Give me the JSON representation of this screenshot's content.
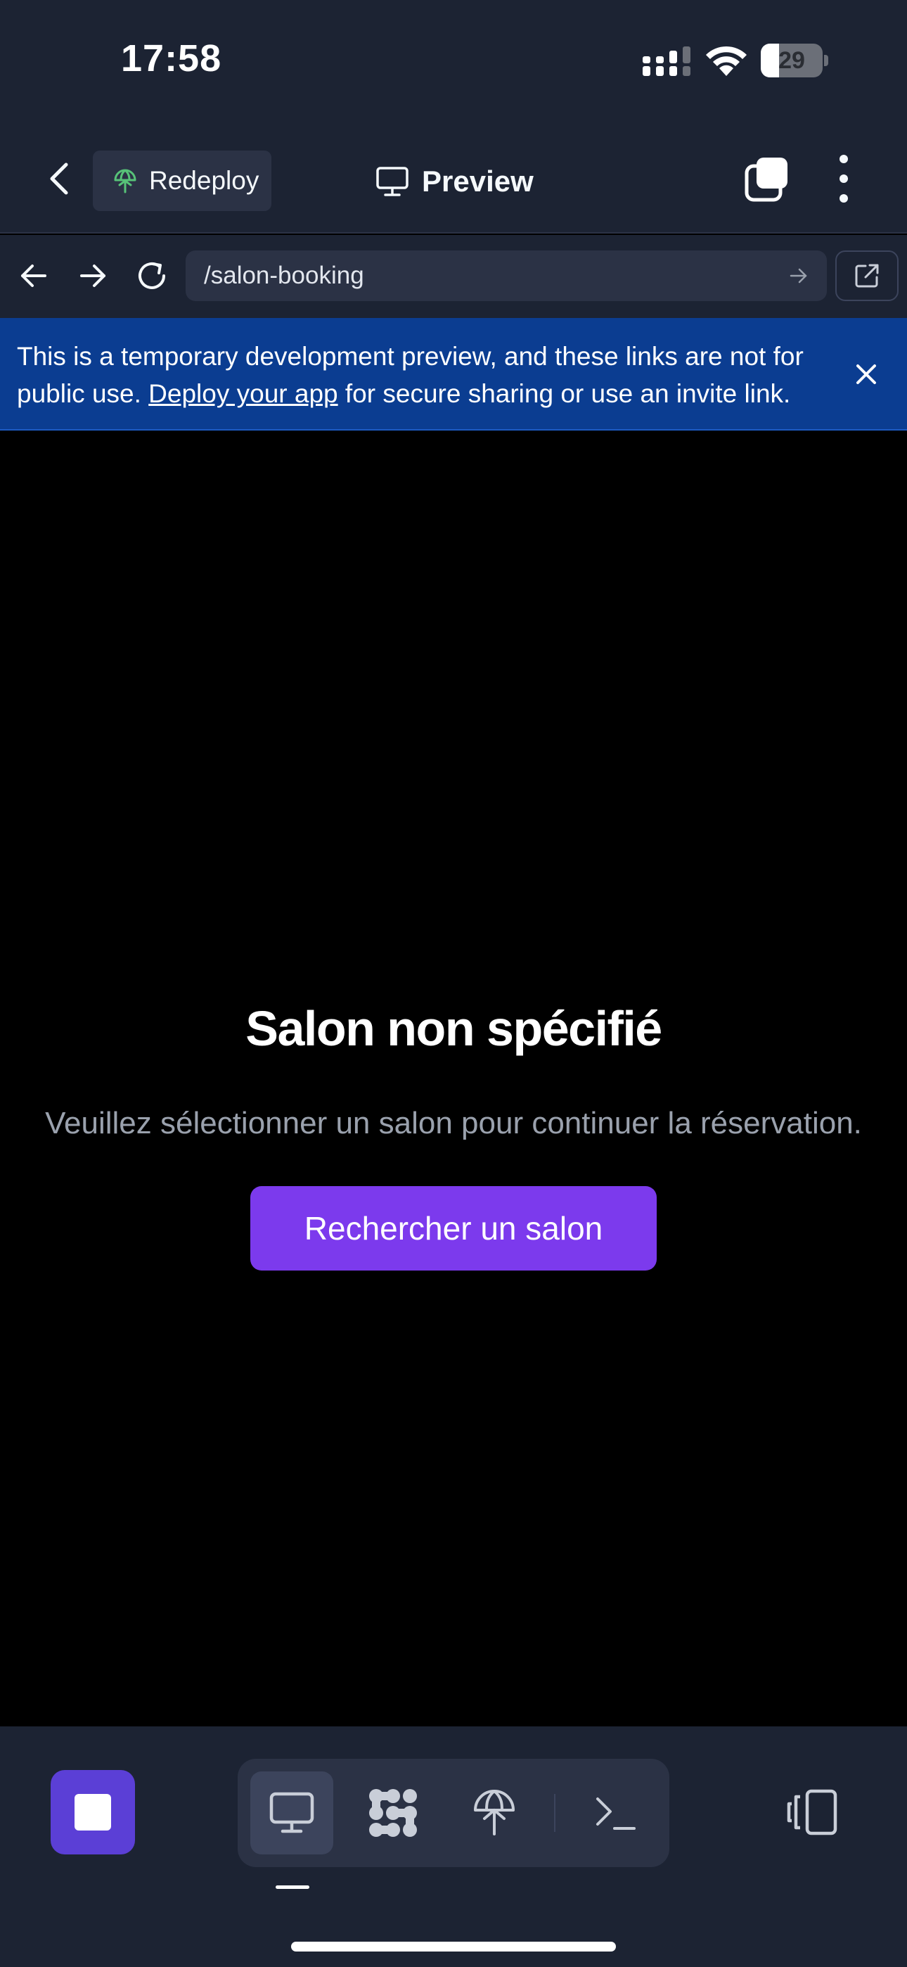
{
  "status_bar": {
    "time": "17:58",
    "battery_level": "29",
    "battery_fraction": 0.29,
    "icons": [
      "cellular-signal-icon",
      "wifi-icon",
      "battery-icon"
    ]
  },
  "toolbar": {
    "back_icon": "chevron-left-icon",
    "redeploy_label": "Redeploy",
    "redeploy_icon": "deploy-icon",
    "redeploy_icon_color": "#57c278",
    "preview_label": "Preview",
    "preview_icon": "monitor-icon",
    "tabs_icon": "tabs-icon",
    "more_icon": "more-vertical-icon"
  },
  "url_bar": {
    "back_icon": "arrow-left-icon",
    "forward_icon": "arrow-right-icon",
    "reload_icon": "reload-icon",
    "url": "/salon-booking",
    "go_icon": "arrow-right-icon",
    "open_external_icon": "external-link-icon"
  },
  "banner": {
    "text_before": "This is a temporary development preview, and these links are not for public use. ",
    "link": "Deploy your app",
    "text_after": " for secure sharing or use an invite link.",
    "close_icon": "close-icon",
    "background": "#0b3d91"
  },
  "main": {
    "title": "Salon non spécifié",
    "message": "Veuillez sélectionner un salon pour continuer la réservation.",
    "button_label": "Rechercher un salon",
    "button_color": "#7c3aed"
  },
  "dock": {
    "stop_icon": "stop-icon",
    "stop_color": "#5b3fd6",
    "tools": [
      {
        "name": "preview-tool",
        "icon": "monitor-icon",
        "active": true
      },
      {
        "name": "workspace-tool",
        "icon": "workspace-icon",
        "active": false
      },
      {
        "name": "deploy-tool",
        "icon": "deploy-icon",
        "active": false
      },
      {
        "name": "shell-tool",
        "icon": "terminal-icon",
        "active": false
      }
    ],
    "devices_icon": "devices-icon"
  },
  "colors": {
    "chrome_bg": "#1c2333",
    "control_bg": "#2b3245",
    "content_bg": "#000000",
    "accent": "#7c3aed"
  }
}
